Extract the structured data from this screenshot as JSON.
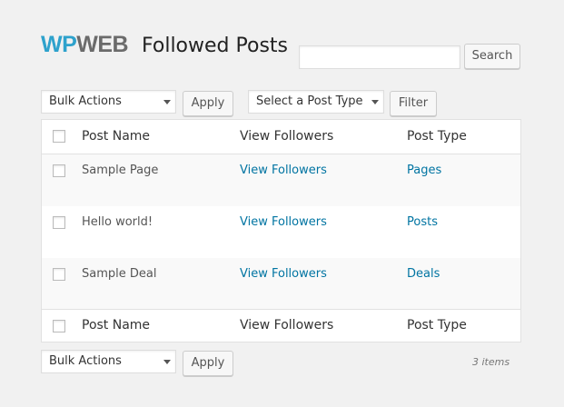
{
  "header": {
    "logo_wp": "WP",
    "logo_web": "WEB",
    "title": "Followed Posts"
  },
  "search": {
    "value": "",
    "button_label": "Search"
  },
  "top_controls": {
    "bulk_actions": "Bulk Actions",
    "apply_label": "Apply",
    "post_type": "Select a Post Type",
    "filter_label": "Filter"
  },
  "table": {
    "columns": [
      "Post Name",
      "View Followers",
      "Post Type"
    ],
    "rows": [
      {
        "name": "Sample Page",
        "followers": "View Followers",
        "type": "Pages"
      },
      {
        "name": "Hello world!",
        "followers": "View Followers",
        "type": "Posts"
      },
      {
        "name": "Sample Deal",
        "followers": "View Followers",
        "type": "Deals"
      }
    ]
  },
  "bottom_controls": {
    "bulk_actions": "Bulk Actions",
    "apply_label": "Apply",
    "item_count": "3 items"
  }
}
